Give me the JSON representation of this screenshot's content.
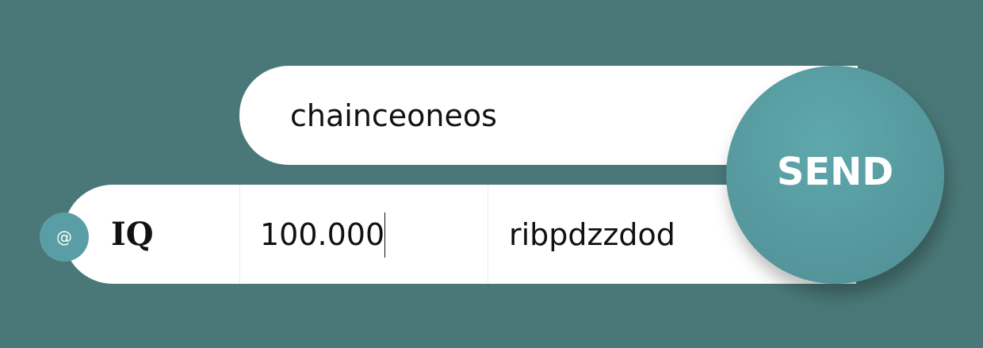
{
  "to_field": {
    "value": "chainceoneos"
  },
  "amount_row": {
    "badge": "@",
    "token": "IQ",
    "amount_value": "100.000",
    "memo_value": "ribpdzzdod"
  },
  "send_button": {
    "label": "SEND"
  },
  "colors": {
    "background": "#4a7878",
    "accent": "#5a9ea5",
    "field": "#ffffff"
  }
}
